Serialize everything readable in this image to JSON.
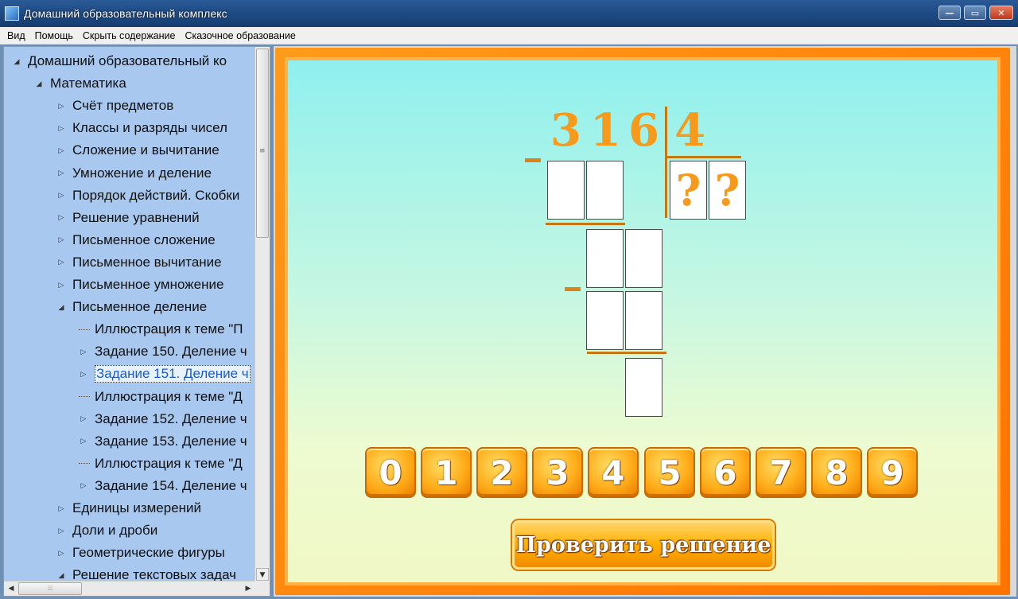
{
  "window": {
    "title": "Домашний образовательный комплекс"
  },
  "menu": [
    "Вид",
    "Помощь",
    "Скрыть содержание",
    "Сказочное образование"
  ],
  "tree": [
    {
      "label": "Домашний образовательный ко",
      "level": 0,
      "toggle": "expanded"
    },
    {
      "label": "Математика",
      "level": 1,
      "toggle": "expanded"
    },
    {
      "label": "Счёт предметов",
      "level": 2,
      "toggle": "collapsed"
    },
    {
      "label": "Классы и разряды чисел",
      "level": 2,
      "toggle": "collapsed"
    },
    {
      "label": "Сложение и вычитание",
      "level": 2,
      "toggle": "collapsed"
    },
    {
      "label": "Умножение и деление",
      "level": 2,
      "toggle": "collapsed"
    },
    {
      "label": "Порядок действий. Скобки",
      "level": 2,
      "toggle": "collapsed"
    },
    {
      "label": "Решение уравнений",
      "level": 2,
      "toggle": "collapsed"
    },
    {
      "label": "Письменное сложение",
      "level": 2,
      "toggle": "collapsed"
    },
    {
      "label": "Письменное вычитание",
      "level": 2,
      "toggle": "collapsed"
    },
    {
      "label": "Письменное умножение",
      "level": 2,
      "toggle": "collapsed"
    },
    {
      "label": "Письменное деление",
      "level": 2,
      "toggle": "expanded"
    },
    {
      "label": "Иллюстрация к теме \"П",
      "level": 3,
      "toggle": "leaf"
    },
    {
      "label": "Задание 150. Деление ч",
      "level": 3,
      "toggle": "collapsed"
    },
    {
      "label": "Задание 151. Деление ч",
      "level": 3,
      "toggle": "collapsed",
      "selected": true
    },
    {
      "label": "Иллюстрация к теме \"Д",
      "level": 3,
      "toggle": "leaf"
    },
    {
      "label": "Задание 152. Деление ч",
      "level": 3,
      "toggle": "collapsed"
    },
    {
      "label": "Задание 153. Деление ч",
      "level": 3,
      "toggle": "collapsed"
    },
    {
      "label": "Иллюстрация к теме \"Д",
      "level": 3,
      "toggle": "leaf"
    },
    {
      "label": "Задание 154. Деление ч",
      "level": 3,
      "toggle": "collapsed"
    },
    {
      "label": "Единицы измерений",
      "level": 2,
      "toggle": "collapsed"
    },
    {
      "label": "Доли и дроби",
      "level": 2,
      "toggle": "collapsed"
    },
    {
      "label": "Геометрические фигуры",
      "level": 2,
      "toggle": "collapsed"
    },
    {
      "label": "Решение текстовых задач",
      "level": 2,
      "toggle": "expanded"
    }
  ],
  "exercise": {
    "dividend_digits": [
      "3",
      "1",
      "6"
    ],
    "divisor": "4",
    "quotient_cells": [
      "?",
      "?"
    ],
    "minus_sign": "–"
  },
  "numpad": [
    "0",
    "1",
    "2",
    "3",
    "4",
    "5",
    "6",
    "7",
    "8",
    "9"
  ],
  "check_button": "Проверить решение",
  "colors": {
    "accent": "#f59a1c",
    "frame": "#ff7f00",
    "tree_bg": "#a8c8ef",
    "title_bar": "#1f4c86"
  }
}
